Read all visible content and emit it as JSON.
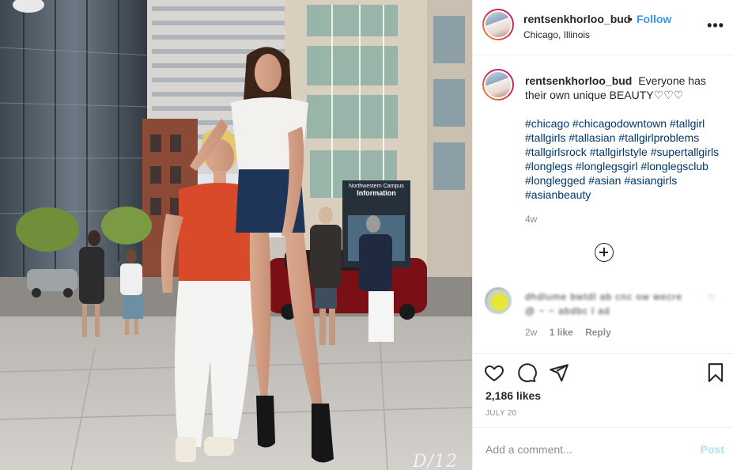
{
  "photo": {
    "watermark": "D/12",
    "sign_text": {
      "line1": "Northwestern Campus",
      "line2": "Information"
    }
  },
  "header": {
    "username": "rentsenkhorloo_bud",
    "separator": "•",
    "follow_label": "Follow",
    "location": "Chicago, Illinois",
    "more_icon": "more-options-icon",
    "more_glyph": "•••"
  },
  "caption": {
    "username": "rentsenkhorloo_bud",
    "text": "Everyone has their own unique BEAUTY♡♡♡",
    "hashtags": "#chicago #chicagodowntown #tallgirl #tallgirls #tallasian #tallgirlproblems #tallgirlsrock #tallgirlstyle #supertallgirls #longlegs #longlegsgirl #longlegsclub #longlegged #asian #asiangirls #asianbeauty",
    "time_ago": "4w"
  },
  "comment": {
    "blurred_text": "dhdlume bwtdl ab cnc ow wecre @ ~ ~ abdbc l ad",
    "heart": "♡",
    "time": "2w",
    "likes": "1 like",
    "reply_label": "Reply"
  },
  "actions": {
    "like_icon": "heart-icon",
    "comment_icon": "comment-icon",
    "share_icon": "share-icon",
    "save_icon": "bookmark-icon",
    "likes_count": "2,186 likes",
    "date": "JULY 20"
  },
  "add_comment": {
    "placeholder": "Add a comment...",
    "post_label": "Post"
  },
  "colors": {
    "link_blue": "#3897f0",
    "hashtag": "#00376b",
    "muted": "#8e8e8e",
    "post_disabled": "#b2dffc"
  }
}
